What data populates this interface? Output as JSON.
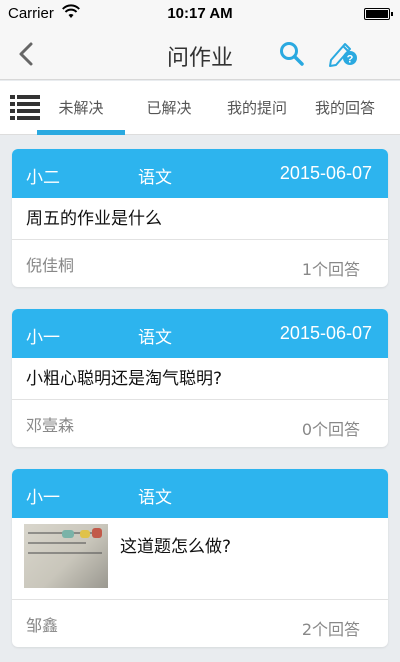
{
  "status_bar": {
    "carrier": "Carrier",
    "time": "10:17 AM"
  },
  "nav": {
    "title": "问作业",
    "back_icon": "chevron-left-icon",
    "search_icon": "search-icon",
    "ask_icon": "ask-question-icon",
    "accent": "#2aa9e0"
  },
  "tabs": {
    "menu_icon": "list-menu-icon",
    "items": [
      {
        "label": "未解决",
        "active": true
      },
      {
        "label": "已解决",
        "active": false
      },
      {
        "label": "我的提问",
        "active": false
      },
      {
        "label": "我的回答",
        "active": false
      }
    ]
  },
  "questions": [
    {
      "author": "小二",
      "subject": "语文",
      "date": "2015-06-07",
      "question": "周五的作业是什么",
      "asker": "倪佳桐",
      "answers": "1个回答"
    },
    {
      "author": "小一",
      "subject": "语文",
      "date": "2015-06-07",
      "question": "小粗心聪明还是淘气聪明?",
      "asker": "邓壹森",
      "answers": "0个回答"
    },
    {
      "author": "小一",
      "subject": "语文",
      "date": "",
      "question": "这道题怎么做?",
      "asker": "邹鑫",
      "answers": "2个回答",
      "has_image": true
    }
  ],
  "colors": {
    "card_header": "#2db4ee",
    "background": "#e9ecef"
  }
}
